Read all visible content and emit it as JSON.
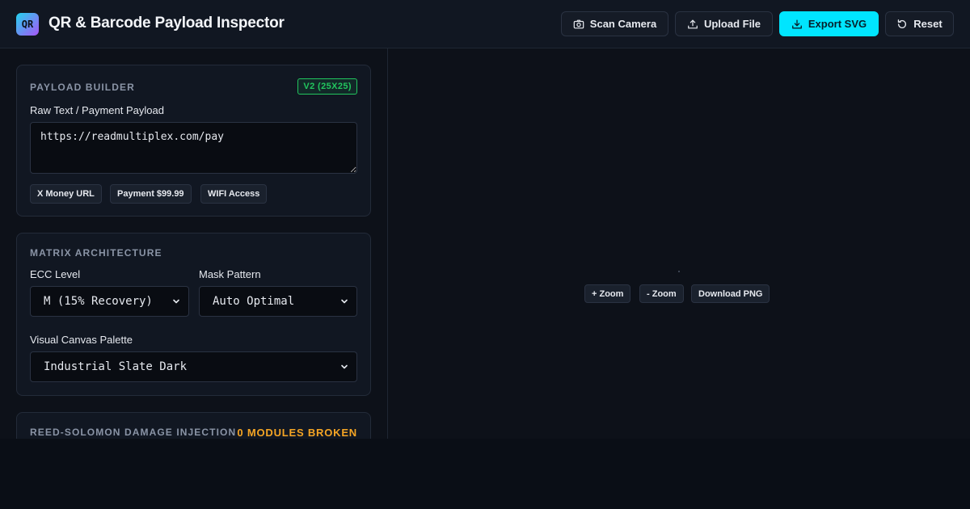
{
  "header": {
    "logo_text": "QR",
    "title": "QR & Barcode Payload Inspector",
    "buttons": {
      "scan_camera": "Scan Camera",
      "upload_file": "Upload File",
      "export_svg": "Export SVG",
      "reset": "Reset"
    },
    "accent_color": "#00e5ff"
  },
  "payload_builder": {
    "title": "PAYLOAD BUILDER",
    "version_badge": "V2 (25X25)",
    "field_label": "Raw Text / Payment Payload",
    "value": "https://readmultiplex.com/pay",
    "presets": [
      "X Money URL",
      "Payment $99.99",
      "WIFI Access"
    ]
  },
  "matrix": {
    "title": "MATRIX ARCHITECTURE",
    "ecc_label": "ECC Level",
    "ecc_value": "M (15% Recovery)",
    "mask_label": "Mask Pattern",
    "mask_value": "Auto Optimal",
    "palette_label": "Visual Canvas Palette",
    "palette_value": "Industrial Slate Dark"
  },
  "damage": {
    "title": "REED-SOLOMON DAMAGE INJECTION",
    "count_text": "0 MODULES BROKEN",
    "count_color": "#f5a524"
  },
  "canvas": {
    "zoom_in": "+ Zoom",
    "zoom_out": "- Zoom",
    "download_png": "Download PNG"
  }
}
